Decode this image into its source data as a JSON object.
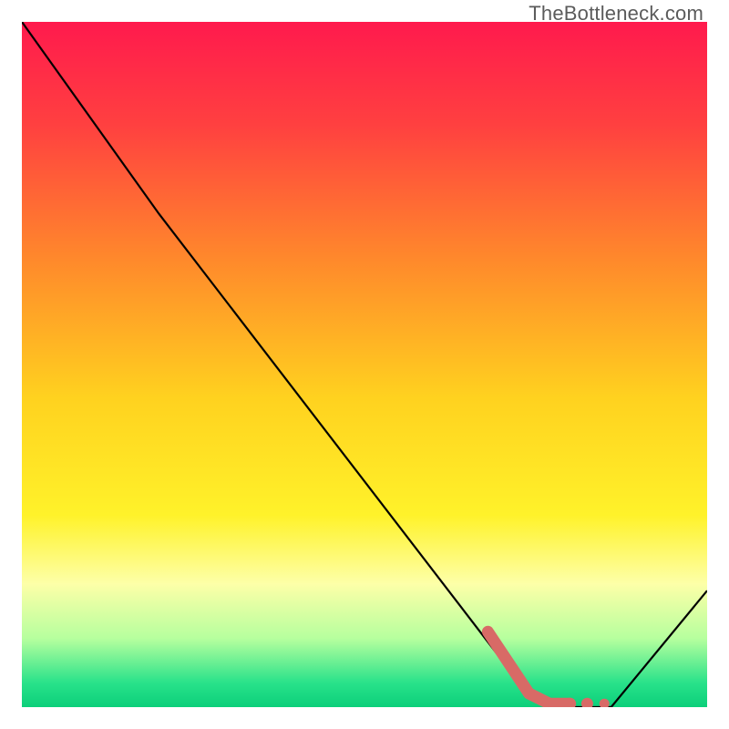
{
  "watermark": "TheBottleneck.com",
  "chart_data": {
    "type": "line",
    "title": "",
    "xlabel": "",
    "ylabel": "",
    "xlim": [
      0,
      100
    ],
    "ylim": [
      0,
      100
    ],
    "series": [
      {
        "name": "bottleneck-curve",
        "x": [
          0,
          20,
          73,
          78,
          86,
          100
        ],
        "y": [
          100,
          72,
          3,
          0,
          0,
          17
        ]
      }
    ],
    "highlight": {
      "name": "optimal-segment",
      "points": [
        {
          "x": 68,
          "y": 11
        },
        {
          "x": 74,
          "y": 2
        },
        {
          "x": 77,
          "y": 0.5
        },
        {
          "x": 80,
          "y": 0.5
        },
        {
          "x": 82.5,
          "y": 0.5
        },
        {
          "x": 85,
          "y": 0.5
        }
      ]
    },
    "gradient_stops": [
      {
        "offset": 0.0,
        "color": "#ff1a4d"
      },
      {
        "offset": 0.15,
        "color": "#ff4040"
      },
      {
        "offset": 0.35,
        "color": "#ff8a2b"
      },
      {
        "offset": 0.55,
        "color": "#ffd21f"
      },
      {
        "offset": 0.72,
        "color": "#fff22a"
      },
      {
        "offset": 0.82,
        "color": "#fdffa8"
      },
      {
        "offset": 0.9,
        "color": "#b6ff9e"
      },
      {
        "offset": 0.965,
        "color": "#28e28a"
      },
      {
        "offset": 1.0,
        "color": "#0ccf7a"
      }
    ],
    "curve_color": "#000000",
    "highlight_color": "#d86a66"
  }
}
